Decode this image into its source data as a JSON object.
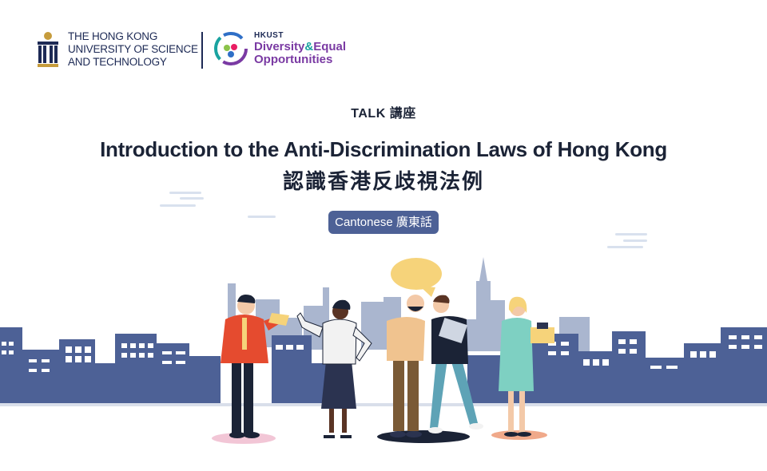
{
  "branding": {
    "university_name_lines": [
      "THE HONG KONG",
      "UNIVERSITY OF SCIENCE",
      "AND TECHNOLOGY"
    ],
    "deo_prefix": "HKUST",
    "deo_line1_a": "Diversity",
    "deo_line1_amp": "&",
    "deo_line1_b": "Equal",
    "deo_line2": "Opportunities"
  },
  "event": {
    "type_label": "TALK 講座",
    "title_en": "Introduction to the Anti-Discrimination Laws of Hong Kong",
    "title_zh": "認識香港反歧視法例",
    "language_badge": "Cantonese 廣東話"
  },
  "colors": {
    "skyline_dark": "#4d6196",
    "skyline_light": "#aab6cf",
    "heading_text": "#1b2336",
    "badge_bg": "#4d6196",
    "brand_navy": "#1d2a55",
    "brand_purple": "#7a3aa3",
    "brand_teal": "#1aa3a0",
    "speech_bubble": "#f6d37a"
  }
}
